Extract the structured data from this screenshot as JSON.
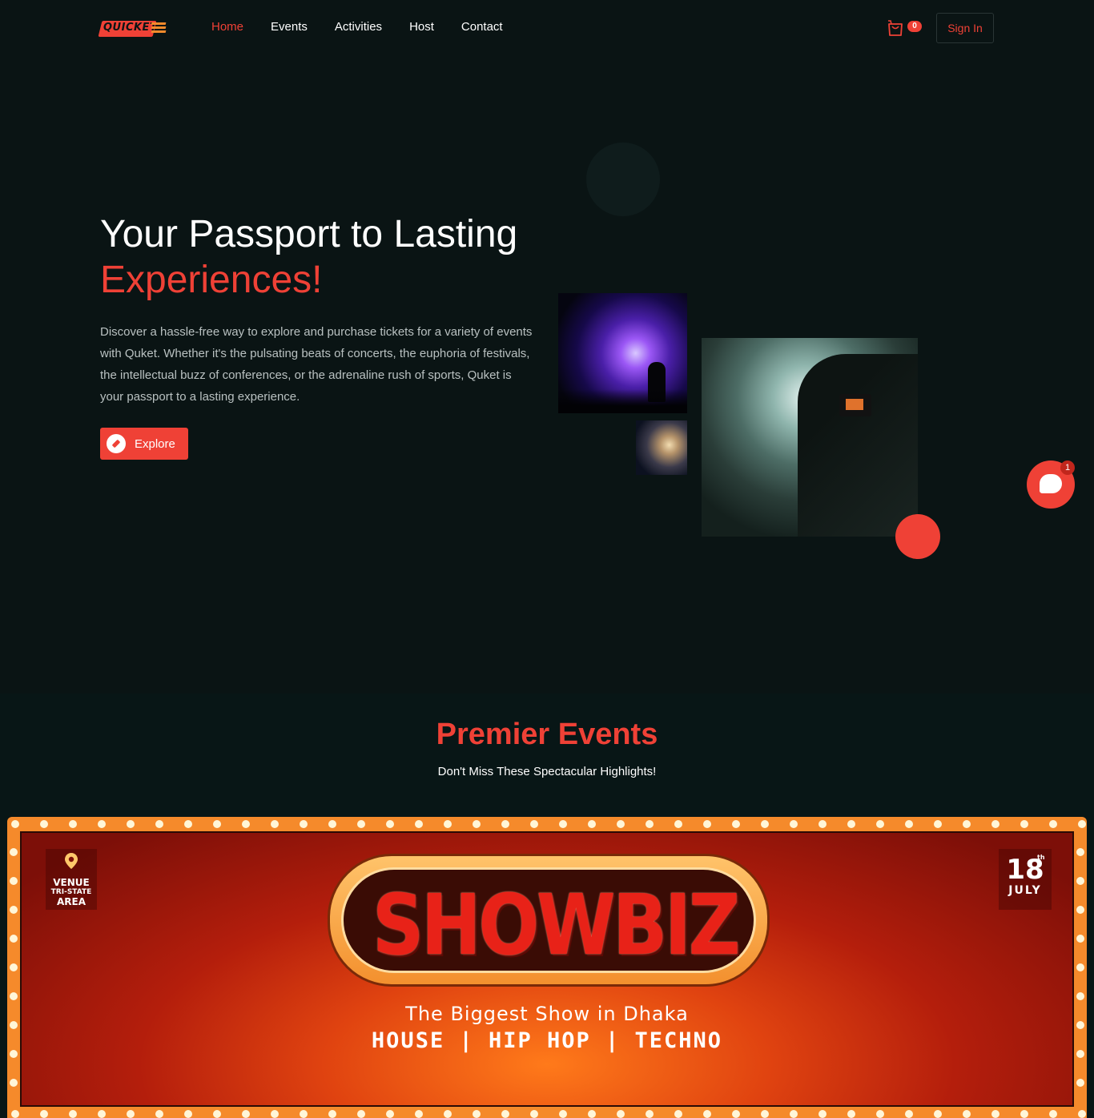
{
  "brand": {
    "logo_text": "QUICKET"
  },
  "nav": {
    "items": [
      {
        "label": "Home",
        "active": true
      },
      {
        "label": "Events",
        "active": false
      },
      {
        "label": "Activities",
        "active": false
      },
      {
        "label": "Host",
        "active": false
      },
      {
        "label": "Contact",
        "active": false
      }
    ]
  },
  "header": {
    "cart_count": "0",
    "signin_label": "Sign In"
  },
  "hero": {
    "title_line1": "Your Passport to Lasting",
    "title_line2": "Experiences!",
    "description": "Discover a hassle-free way to explore and purchase tickets for a variety of events with Quket. Whether it's the pulsating beats of concerts, the euphoria of festivals, the intellectual buzz of conferences, or the adrenaline rush of sports, Quket is your passport to a lasting experience.",
    "explore_label": "Explore"
  },
  "chat": {
    "badge": "1"
  },
  "events": {
    "title": "Premier Events",
    "subtitle": "Don't Miss These Spectacular Highlights!"
  },
  "banner": {
    "venue_label": "VENUE",
    "venue_line2": "TRI-STATE",
    "venue_line3": "AREA",
    "date_day": "18",
    "date_suffix": "th",
    "date_month": "JULY",
    "headline": "SHOWBIZ",
    "tagline": "The Biggest Show in Dhaka",
    "genres": "HOUSE | HIP HOP | TECHNO"
  },
  "colors": {
    "accent": "#ef4136",
    "background": "#0a1414",
    "banner_frame": "#f58a2b"
  },
  "icons": {
    "cart": "shopping-bag-icon",
    "explore": "compass-icon",
    "chat": "chat-icon",
    "venue": "map-pin-icon"
  }
}
